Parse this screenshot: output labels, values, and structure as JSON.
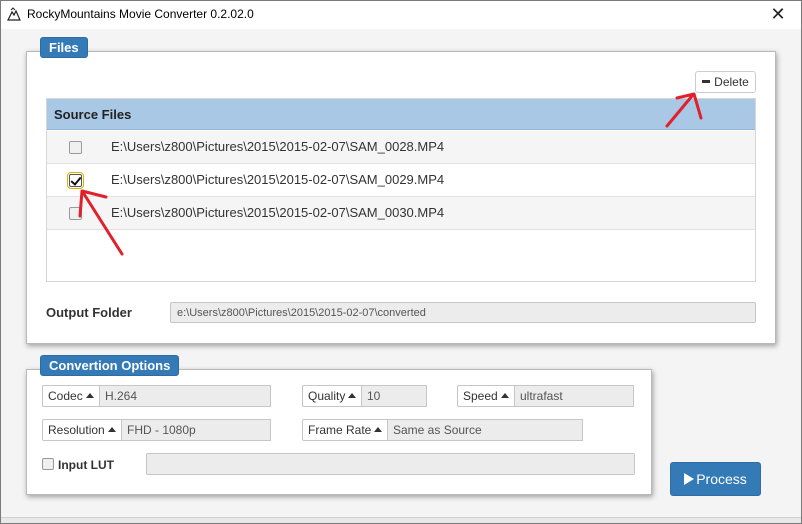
{
  "window": {
    "title": "RockyMountains Movie Converter 0.2.02.0",
    "close_symbol": "✕"
  },
  "files_panel": {
    "label": "Files",
    "delete_label": "Delete",
    "table_header": "Source Files",
    "rows": [
      {
        "path": "E:\\Users\\z800\\Pictures\\2015\\2015-02-07\\SAM_0028.MP4",
        "checked": false
      },
      {
        "path": "E:\\Users\\z800\\Pictures\\2015\\2015-02-07\\SAM_0029.MP4",
        "checked": true
      },
      {
        "path": "E:\\Users\\z800\\Pictures\\2015\\2015-02-07\\SAM_0030.MP4",
        "checked": false
      }
    ],
    "output_label": "Output Folder",
    "output_value": "e:\\Users\\z800\\Pictures\\2015\\2015-02-07\\converted"
  },
  "options_panel": {
    "label": "Convertion Options",
    "codec": {
      "label": "Codec",
      "value": "H.264"
    },
    "quality": {
      "label": "Quality",
      "value": "10"
    },
    "speed": {
      "label": "Speed",
      "value": "ultrafast"
    },
    "resolution": {
      "label": "Resolution",
      "value": "FHD - 1080p"
    },
    "frame_rate": {
      "label": "Frame Rate",
      "value": "Same as Source"
    },
    "input_lut": {
      "label": "Input LUT",
      "value": ""
    }
  },
  "process_label": "Process",
  "colors": {
    "accent": "#337ab7",
    "table_header": "#a8c8e6",
    "annotation": "#e0202a"
  }
}
